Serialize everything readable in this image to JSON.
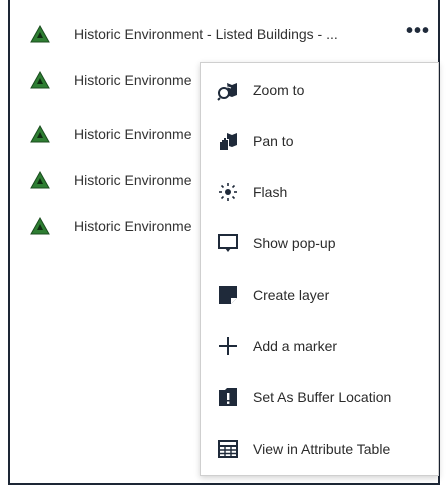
{
  "list": {
    "items": [
      {
        "label": "Historic Environment - Listed Buildings - ...",
        "more_label": "•••"
      },
      {
        "label": "Historic Environme"
      },
      {
        "label": "Historic Environme"
      },
      {
        "label": "Historic Environme"
      },
      {
        "label": "Historic Environme"
      }
    ],
    "marker_color": "#2e7d32"
  },
  "menu": {
    "items": [
      {
        "label": "Zoom to",
        "icon": "zoom-to-icon"
      },
      {
        "label": "Pan to",
        "icon": "pan-to-icon"
      },
      {
        "label": "Flash",
        "icon": "flash-icon"
      },
      {
        "label": "Show pop-up",
        "icon": "popup-icon"
      },
      {
        "label": "Create layer",
        "icon": "create-layer-icon"
      },
      {
        "label": "Add a marker",
        "icon": "add-marker-icon"
      },
      {
        "label": "Set As Buffer Location",
        "icon": "buffer-location-icon"
      },
      {
        "label": "View in Attribute Table",
        "icon": "attribute-table-icon"
      }
    ]
  }
}
